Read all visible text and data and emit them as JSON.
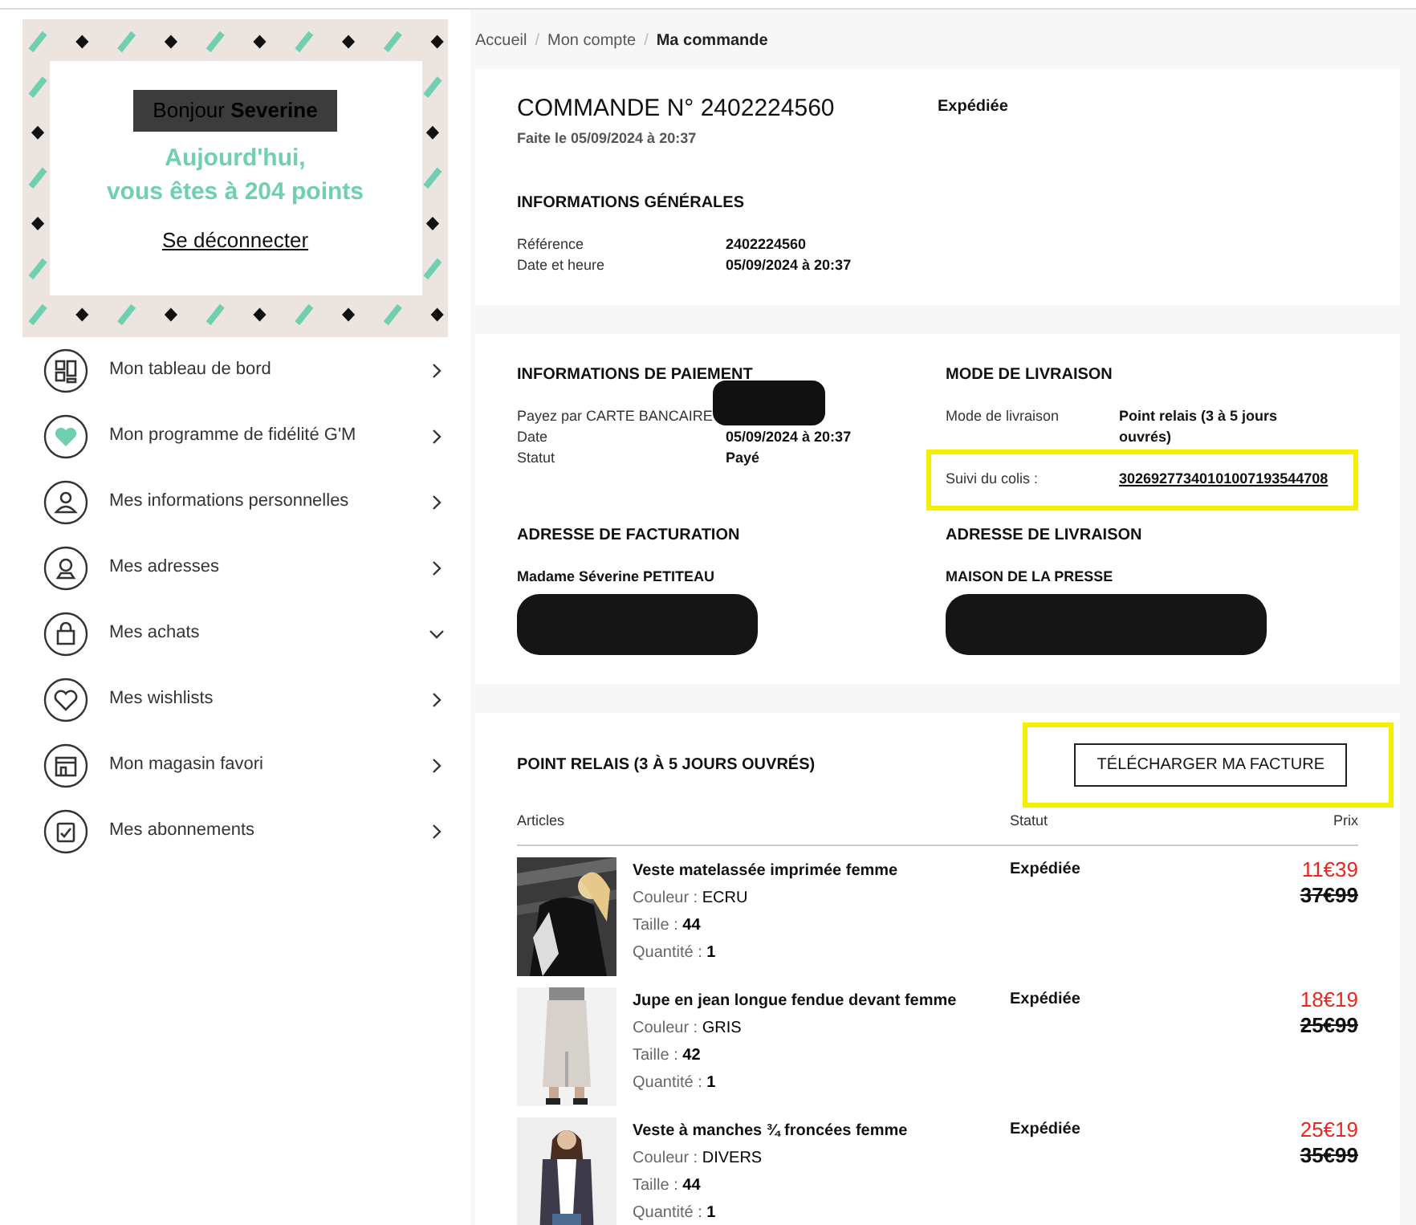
{
  "greeting": {
    "hello": "Bonjour",
    "name": "Severine",
    "points_line1": "Aujourd'hui,",
    "points_line2": "vous êtes à 204 points",
    "logout": "Se déconnecter"
  },
  "sidebar": {
    "items": [
      {
        "label": "Mon tableau de bord",
        "expanded": false
      },
      {
        "label": "Mon programme de fidélité G'M",
        "expanded": false
      },
      {
        "label": "Mes informations personnelles",
        "expanded": false
      },
      {
        "label": "Mes adresses",
        "expanded": false
      },
      {
        "label": "Mes achats",
        "expanded": true
      },
      {
        "label": "Mes wishlists",
        "expanded": false
      },
      {
        "label": "Mon magasin favori",
        "expanded": false
      },
      {
        "label": "Mes abonnements",
        "expanded": false
      }
    ]
  },
  "breadcrumb": [
    {
      "label": "Accueil",
      "current": false
    },
    {
      "separator": "/",
      "label": "Mon compte",
      "current": false
    },
    {
      "separator": "/",
      "label": "Ma commande",
      "current": true
    }
  ],
  "order": {
    "title": "COMMANDE N° 2402224560",
    "made": "Faite le 05/09/2024 à 20:37",
    "status": "Expédiée",
    "general": {
      "heading": "INFORMATIONS GÉNÉRALES",
      "rows": [
        {
          "label": "Référence",
          "value": "2402224560"
        },
        {
          "label": "Date et heure",
          "value": "05/09/2024 à 20:37"
        }
      ]
    }
  },
  "payment": {
    "heading": "INFORMATIONS DE PAIEMENT",
    "rows": [
      {
        "label": "Payez par CARTE BANCAIRE"
      },
      {
        "label": "Date",
        "value": "05/09/2024 à 20:37"
      },
      {
        "label": "Statut",
        "value": "Payé"
      }
    ]
  },
  "delivery": {
    "heading": "MODE DE LIVRAISON",
    "mode_label": "Mode de livraison",
    "mode_value": "Point relais (3 à 5 jours ouvrés)",
    "tracking_label": "Suivi du colis :",
    "tracking_number": "30269277340101007193544708"
  },
  "billing_address": {
    "heading": "ADRESSE DE FACTURATION",
    "name": "Madame Séverine PETITEAU"
  },
  "shipping_address": {
    "heading": "ADRESSE DE LIVRAISON",
    "name": "MAISON DE LA PRESSE"
  },
  "shipment": {
    "heading": "POINT RELAIS (3 À 5 JOURS OUVRÉS)",
    "invoice_button": "TÉLÉCHARGER MA FACTURE",
    "columns": [
      "Articles",
      "Statut",
      "Prix"
    ],
    "items": [
      {
        "name": "Veste matelassée imprimée femme",
        "color_label": "Couleur :",
        "colour_name": "ECRU",
        "size_label": "Taille :",
        "size": "44",
        "qty_label": "Quantité :",
        "qty": "1",
        "status": "Expédiée",
        "price": "11€39",
        "old_price": "37€99"
      },
      {
        "name": "Jupe en jean longue fendue devant femme",
        "color_label": "Couleur :",
        "colour_name": "GRIS",
        "size_label": "Taille :",
        "size": "42",
        "qty_label": "Quantité :",
        "qty": "1",
        "status": "Expédiée",
        "price": "18€19",
        "old_price": "25€99"
      },
      {
        "name": "Veste à manches ¾ froncées femme",
        "color_label": "Couleur :",
        "colour_name": "DIVERS",
        "size_label": "Taille :",
        "size": "44",
        "qty_label": "Quantité :",
        "qty": "1",
        "status": "Expédiée",
        "price": "25€19",
        "old_price": "35€99"
      }
    ]
  }
}
